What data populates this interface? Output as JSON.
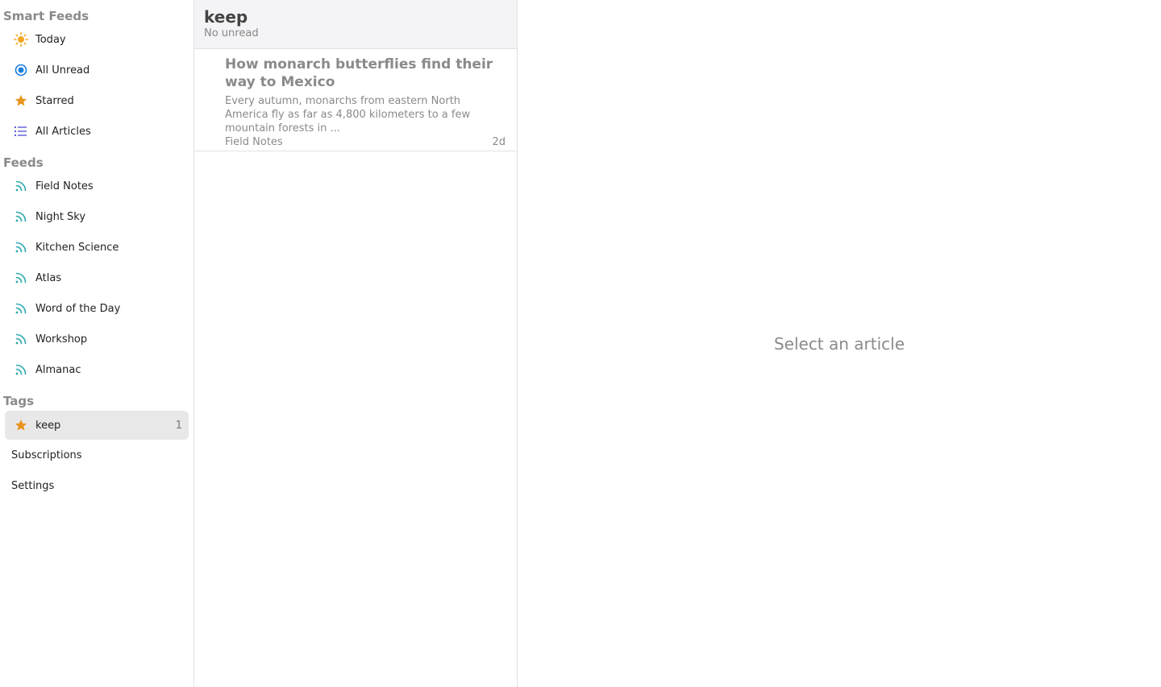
{
  "sidebar": {
    "smart_feeds_header": "Smart Feeds",
    "smart_feeds": [
      {
        "label": "Today",
        "icon": "sun-icon"
      },
      {
        "label": "All Unread",
        "icon": "unread-circle-icon"
      },
      {
        "label": "Starred",
        "icon": "star-icon"
      },
      {
        "label": "All Articles",
        "icon": "list-icon"
      }
    ],
    "feeds_header": "Feeds",
    "feeds": [
      {
        "label": "Field Notes",
        "icon": "rss-icon"
      },
      {
        "label": "Night Sky",
        "icon": "rss-icon"
      },
      {
        "label": "Kitchen Science",
        "icon": "rss-icon"
      },
      {
        "label": "Atlas",
        "icon": "rss-icon"
      },
      {
        "label": "Word of the Day",
        "icon": "rss-icon"
      },
      {
        "label": "Workshop",
        "icon": "rss-icon"
      },
      {
        "label": "Almanac",
        "icon": "rss-icon"
      }
    ],
    "tags_header": "Tags",
    "tags": [
      {
        "label": "keep",
        "count": "1",
        "icon": "star-icon"
      }
    ],
    "subscriptions_label": "Subscriptions",
    "settings_label": "Settings"
  },
  "list": {
    "title": "keep",
    "subtitle": "No unread",
    "articles": [
      {
        "title": "How monarch butterflies find their way to Mexico",
        "summary": "Every autumn, monarchs from eastern North America fly as far as 4,800 kilometers to a few mountain forests in ...",
        "feed": "Field Notes",
        "age": "2d"
      }
    ]
  },
  "reader": {
    "empty_text": "Select an article"
  },
  "colors": {
    "sun": "#f5a623",
    "unread": "#1a7fe0",
    "star": "#e8961e",
    "list": "#5a5ad6",
    "rss": "#2aa8b0",
    "selected_bg": "#e8e8e9"
  }
}
